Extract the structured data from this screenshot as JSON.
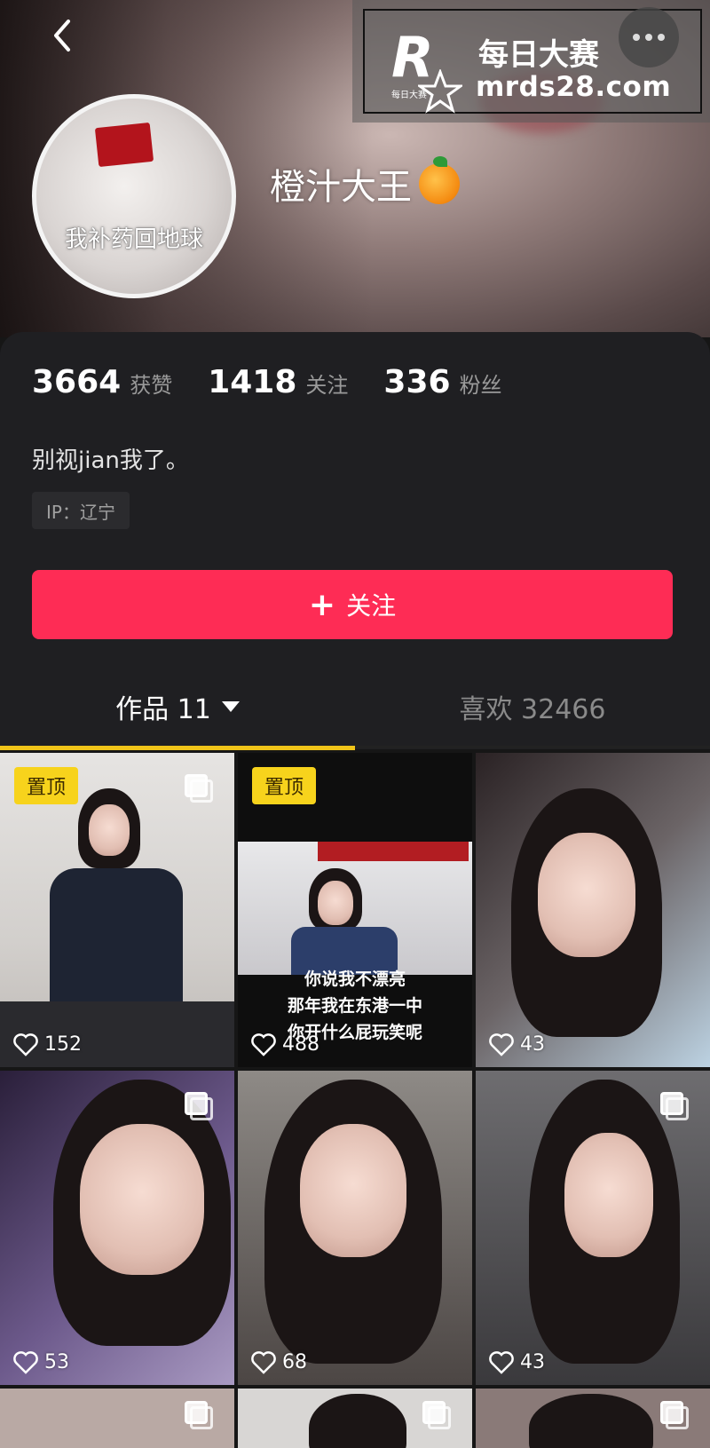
{
  "watermark": {
    "title": "每日大赛",
    "url": "mrds28.com",
    "logo_letter": "R",
    "logo_small": "每日大赛"
  },
  "header": {
    "back_icon": "chevron-left-icon",
    "more_icon": "more-icon"
  },
  "profile": {
    "avatar_caption": "我补药回地球",
    "name": "橙汁大王",
    "name_emoji": "orange-icon",
    "bio": "别视jian我了。",
    "ip": "IP：辽宁",
    "stats": [
      {
        "value": "3664",
        "label": "获赞"
      },
      {
        "value": "1418",
        "label": "关注"
      },
      {
        "value": "336",
        "label": "粉丝"
      }
    ],
    "follow_plus": "+",
    "follow_label": "关注"
  },
  "tabs": {
    "works": "作品 11",
    "likes": "喜欢 32466"
  },
  "accent": {
    "follow": "#fe2c55",
    "tab_underline": "#f0c419",
    "pin": "#f7d31c"
  },
  "grid": {
    "pin_label": "置顶",
    "tiles": [
      {
        "likes": "152",
        "pinned": true
      },
      {
        "likes": "488",
        "pinned": true,
        "caption": [
          "你说我不漂亮",
          "那年我在东港一中",
          "你开什么屁玩笑呢"
        ]
      },
      {
        "likes": "43"
      },
      {
        "likes": "53"
      },
      {
        "likes": "68"
      },
      {
        "likes": "43"
      }
    ]
  }
}
